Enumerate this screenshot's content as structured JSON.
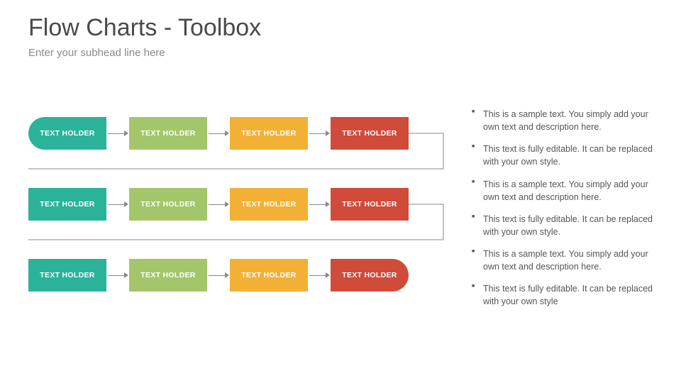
{
  "title": "Flow Charts - Toolbox",
  "subhead": "Enter your subhead line here",
  "rows": [
    {
      "boxes": [
        {
          "label": "TEXT HOLDER",
          "color": "teal",
          "shape": "pill-left"
        },
        {
          "label": "TEXT HOLDER",
          "color": "green",
          "shape": "rect"
        },
        {
          "label": "TEXT HOLDER",
          "color": "orange",
          "shape": "rect"
        },
        {
          "label": "TEXT HOLDER",
          "color": "red",
          "shape": "rect"
        }
      ]
    },
    {
      "boxes": [
        {
          "label": "TEXT HOLDER",
          "color": "teal",
          "shape": "rect"
        },
        {
          "label": "TEXT HOLDER",
          "color": "green",
          "shape": "rect"
        },
        {
          "label": "TEXT HOLDER",
          "color": "orange",
          "shape": "rect"
        },
        {
          "label": "TEXT HOLDER",
          "color": "red",
          "shape": "rect"
        }
      ]
    },
    {
      "boxes": [
        {
          "label": "TEXT HOLDER",
          "color": "teal",
          "shape": "rect"
        },
        {
          "label": "TEXT HOLDER",
          "color": "green",
          "shape": "rect"
        },
        {
          "label": "TEXT HOLDER",
          "color": "orange",
          "shape": "rect"
        },
        {
          "label": "TEXT HOLDER",
          "color": "red",
          "shape": "pill-right"
        }
      ]
    }
  ],
  "bullets": [
    "This is a sample text. You simply add your own text and description here.",
    "This text is fully editable. It can be replaced with your own style.",
    "This is a sample text. You simply add your own text and description here.",
    "This text is fully editable. It can be replaced with your own style.",
    "This is a sample text. You simply add your own text and description here.",
    "This text is fully editable. It can be replaced with your own style"
  ]
}
